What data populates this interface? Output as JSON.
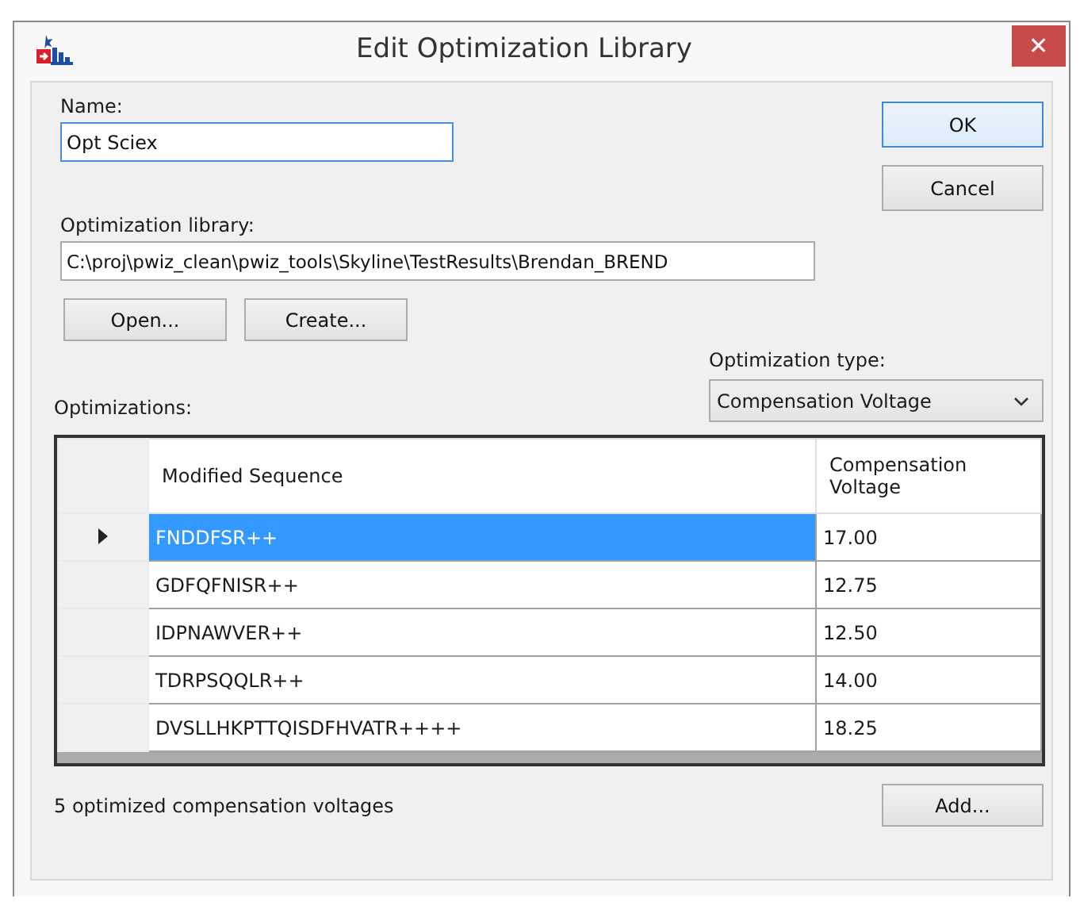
{
  "window": {
    "title": "Edit Optimization Library",
    "close": "✕"
  },
  "name_field": {
    "label": "Name:",
    "value": "Opt Sciex"
  },
  "library_field": {
    "label": "Optimization library:",
    "value": "C:\\proj\\pwiz_clean\\pwiz_tools\\Skyline\\TestResults\\Brendan_BREND"
  },
  "library_buttons": [
    "Open...",
    "Create..."
  ],
  "dialog_buttons": [
    "OK",
    "Cancel"
  ],
  "optimization_type": {
    "label": "Optimization type:",
    "value": "Compensation Voltage"
  },
  "optimizations": {
    "label": "Optimizations:",
    "columns": [
      "Modified Sequence",
      "Compensation Voltage"
    ],
    "rows": [
      {
        "cells": [
          "FNDDFSR++",
          "17.00"
        ],
        "selected": true
      },
      {
        "cells": [
          "GDFQFNISR++",
          "12.75"
        ],
        "selected": false
      },
      {
        "cells": [
          "IDPNAWVER++",
          "12.50"
        ],
        "selected": false
      },
      {
        "cells": [
          "TDRPSQQLR++",
          "14.00"
        ],
        "selected": false
      },
      {
        "cells": [
          "DVSLLHKPTTQISDFHVATR++++",
          "18.25"
        ],
        "selected": false
      }
    ]
  },
  "status": "5 optimized compensation voltages",
  "add_button": "Add..."
}
